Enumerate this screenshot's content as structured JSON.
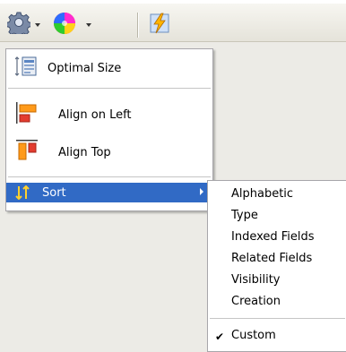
{
  "toolbar": {
    "settings_icon": "gear-icon",
    "color_icon": "color-wheel-icon",
    "edit_icon": "lightning-pencil-icon"
  },
  "layout_menu": {
    "optimal_size": "Optimal Size",
    "align_left": "Align on Left",
    "align_top": "Align Top",
    "sort": "Sort"
  },
  "sort_menu": {
    "items": [
      "Alphabetic",
      "Type",
      "Indexed Fields",
      "Related Fields",
      "Visibility",
      "Creation"
    ],
    "custom": "Custom",
    "custom_checked": true
  },
  "colors": {
    "highlight": "#316ac5",
    "menu_bg": "#ffffff",
    "toolbar_bg": "#ecebe6"
  }
}
